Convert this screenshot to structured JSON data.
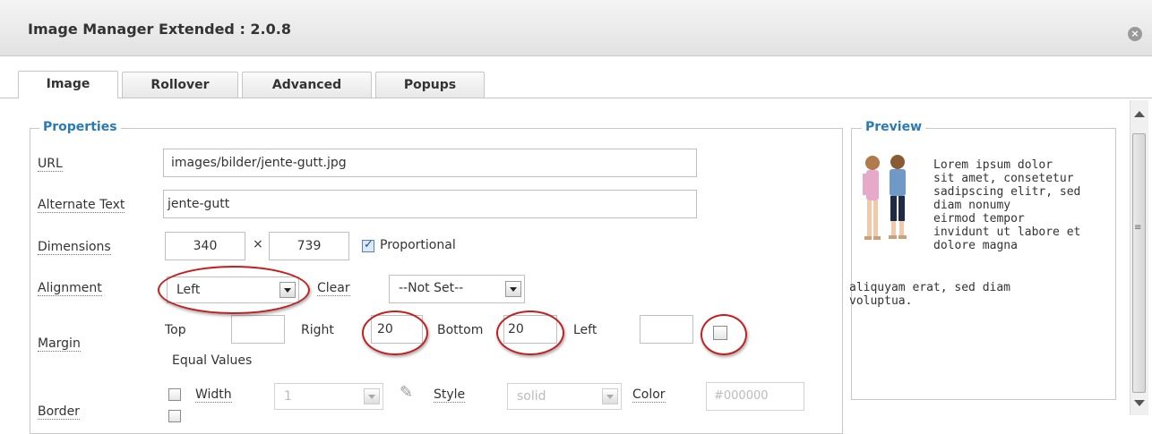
{
  "window": {
    "title": "Image Manager Extended : 2.0.8"
  },
  "tabs": [
    {
      "label": "Image",
      "active": true
    },
    {
      "label": "Rollover",
      "active": false
    },
    {
      "label": "Advanced",
      "active": false
    },
    {
      "label": "Popups",
      "active": false
    }
  ],
  "properties": {
    "legend": "Properties",
    "url": {
      "label": "URL",
      "value": "images/bilder/jente-gutt.jpg"
    },
    "alternate_text": {
      "label": "Alternate Text",
      "value": "jente-gutt"
    },
    "dimensions": {
      "label": "Dimensions",
      "width": "340",
      "separator": "×",
      "height": "739",
      "proportional_label": "Proportional",
      "proportional_checked": true
    },
    "alignment": {
      "label": "Alignment",
      "value": "Left",
      "clear_label": "Clear",
      "clear_value": "--Not Set--"
    },
    "margin": {
      "label": "Margin",
      "top_label": "Top",
      "top_value": "",
      "right_label": "Right",
      "right_value": "20",
      "bottom_label": "Bottom",
      "bottom_value": "20",
      "left_label": "Left",
      "left_value": "",
      "equal_values_label": "Equal Values",
      "equal_values_checked": false
    },
    "border": {
      "label": "Border",
      "width_label": "Width",
      "width_value": "1",
      "style_label": "Style",
      "style_value": "solid",
      "color_label": "Color",
      "color_value": "#000000",
      "enabled": false
    }
  },
  "preview": {
    "legend": "Preview",
    "lines": [
      "Lorem ipsum dolor",
      "sit amet, consetetur",
      "sadipscing elitr, sed",
      "diam nonumy",
      "eirmod tempor",
      "invidunt ut labore et",
      "dolore magna"
    ],
    "lines_full": [
      "aliquyam erat, sed diam",
      "voluptua."
    ]
  },
  "colors": {
    "accent": "#2a7ab5",
    "highlight_ring": "#c21f1f"
  }
}
